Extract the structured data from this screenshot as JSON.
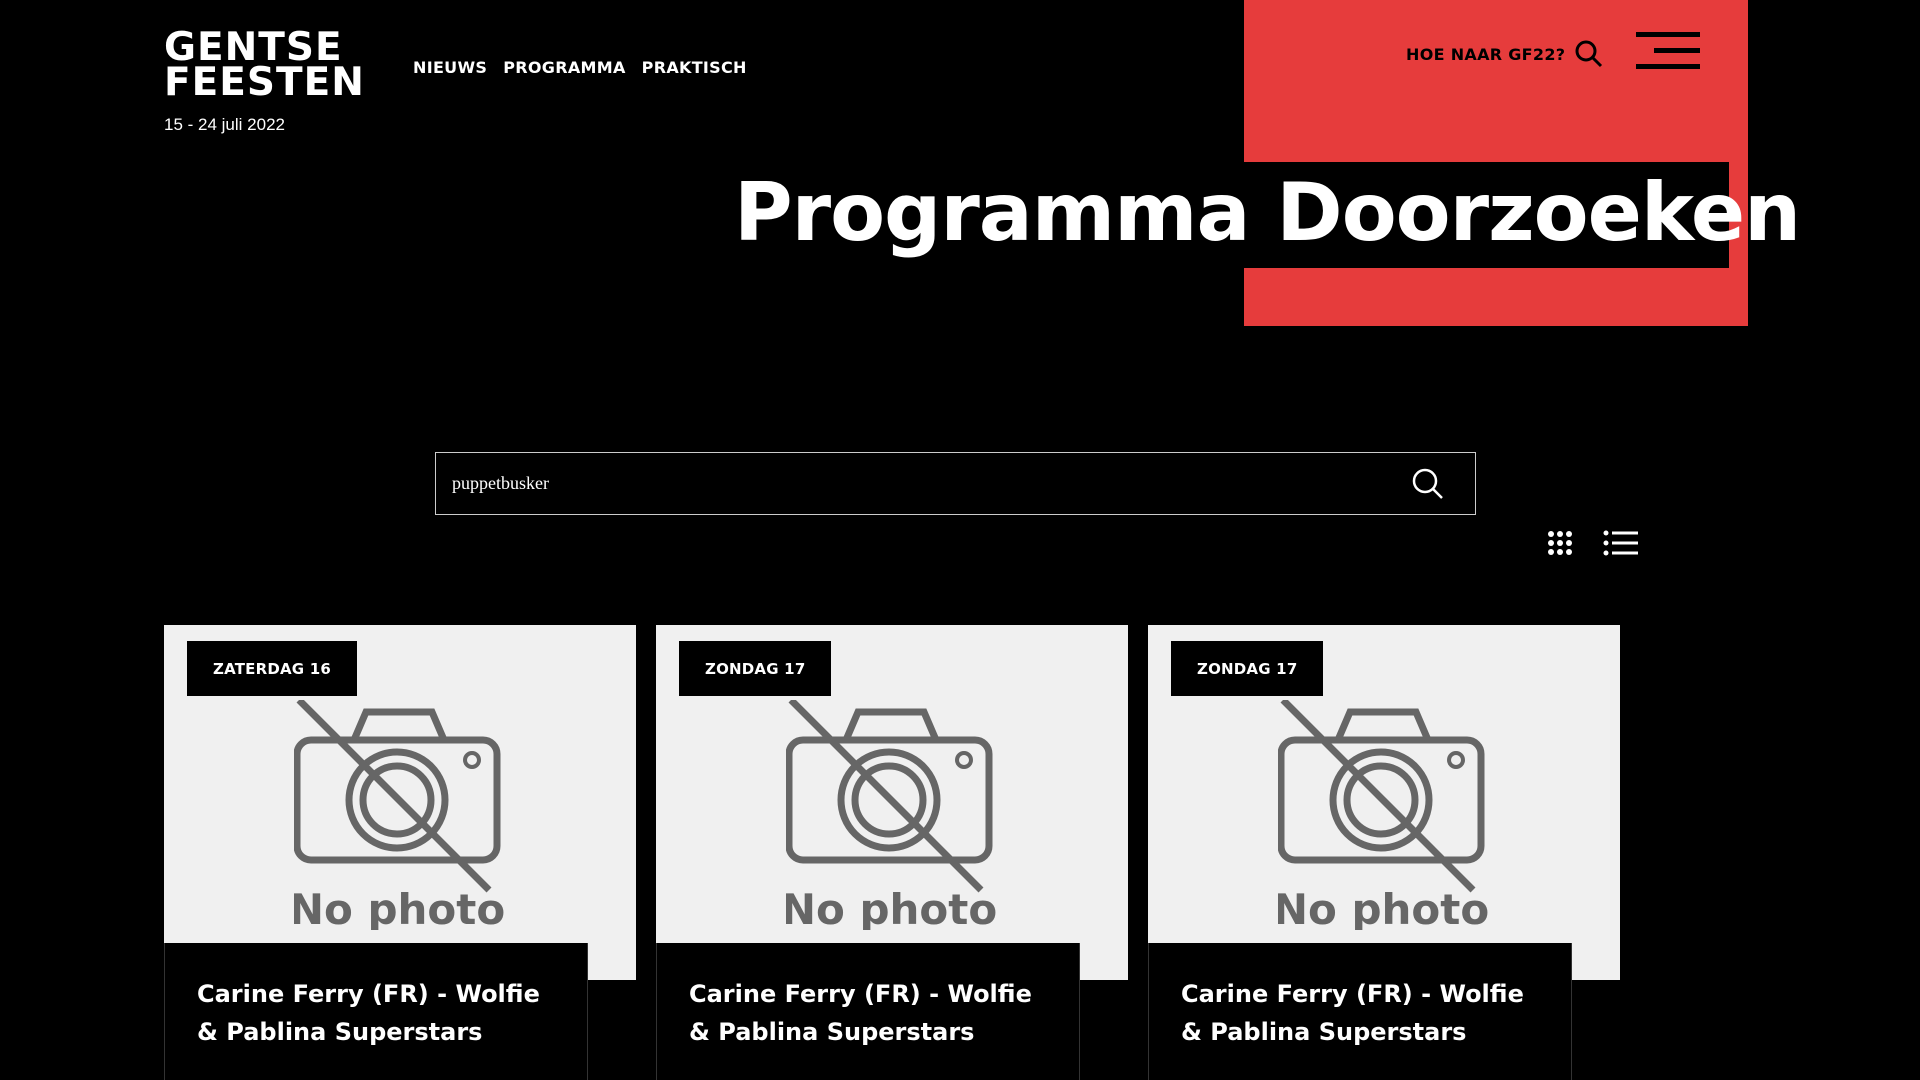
{
  "brand": {
    "logo_line1": "GENTSE",
    "logo_line2": "FEESTEN",
    "dates": "15 - 24 juli 2022",
    "accent_color": "#e63c3c"
  },
  "nav": {
    "items": [
      {
        "label": "NIEUWS"
      },
      {
        "label": "PROGRAMMA"
      },
      {
        "label": "PRAKTISCH"
      }
    ]
  },
  "header": {
    "how_to_link": "HOE NAAR GF22?",
    "search_icon": "search-icon",
    "menu_icon": "hamburger-menu-icon"
  },
  "page": {
    "title": "Programma Doorzoeken"
  },
  "search": {
    "value": "puppetbusker",
    "button_icon": "search-icon"
  },
  "view_toggles": {
    "grid_icon": "grid-view-icon",
    "list_icon": "list-view-icon"
  },
  "results": [
    {
      "day": "ZATERDAG 16",
      "image_label": "No photo",
      "title": "Carine Ferry (FR) - Wolfie & Pablina Superstars"
    },
    {
      "day": "ZONDAG 17",
      "image_label": "No photo",
      "title": "Carine Ferry (FR) - Wolfie & Pablina Superstars"
    },
    {
      "day": "ZONDAG 17",
      "image_label": "No photo",
      "title": "Carine Ferry (FR) - Wolfie & Pablina Superstars"
    }
  ]
}
